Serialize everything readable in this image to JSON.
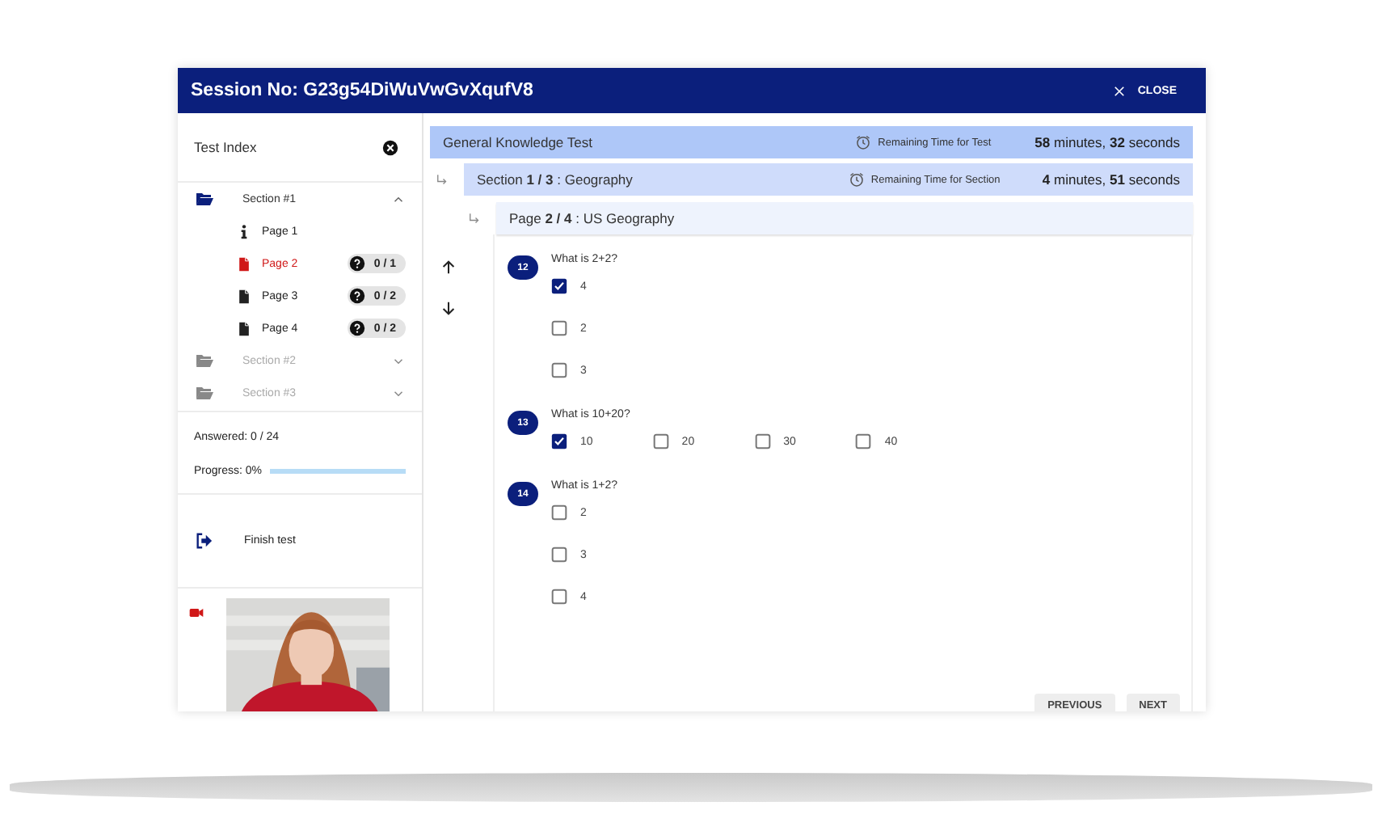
{
  "window": {
    "title": "Session No: G23g54DiWuVwGvXqufV8",
    "close_label": "CLOSE"
  },
  "sidebar": {
    "title": "Test Index",
    "sections": [
      {
        "label": "Section #1",
        "expanded": true,
        "disabled": false,
        "pages": [
          {
            "label": "Page 1",
            "kind": "info",
            "selected": false
          },
          {
            "label": "Page 2",
            "kind": "page",
            "selected": true,
            "badge": "0 / 1"
          },
          {
            "label": "Page 3",
            "kind": "page",
            "selected": false,
            "badge": "0 / 2"
          },
          {
            "label": "Page 4",
            "kind": "page",
            "selected": false,
            "badge": "0 / 2"
          }
        ]
      },
      {
        "label": "Section #2",
        "expanded": false,
        "disabled": true
      },
      {
        "label": "Section #3",
        "expanded": false,
        "disabled": true
      }
    ],
    "answered": "Answered: 0 / 24",
    "progress_label": "Progress: 0%",
    "progress": {
      "level": 0
    },
    "finish_label": "Finish test",
    "camera": {
      "on": true
    }
  },
  "test": {
    "title": "General Knowledge Test",
    "timer_label": "Remaining Time for Test",
    "time": "**58** minutes, **32** seconds"
  },
  "section": {
    "title": "Section  **1 / 3** : Geography",
    "timer_label": "Remaining Time for Section",
    "time": "**4** minutes, **51** seconds"
  },
  "page": {
    "title": "Page  **2 / 4** : US Geography"
  },
  "questions": [
    {
      "number": "12",
      "text": "What is 2+2?",
      "kind": "column",
      "options": [
        {
          "label": "4",
          "checked": true
        },
        {
          "label": "2",
          "checked": false
        },
        {
          "label": "3",
          "checked": false
        }
      ]
    },
    {
      "number": "13",
      "text": "What is 10+20?",
      "kind": "row",
      "options": [
        {
          "label": "10",
          "checked": true
        },
        {
          "label": "20",
          "checked": false
        },
        {
          "label": "30",
          "checked": false
        },
        {
          "label": "40",
          "checked": false
        }
      ]
    },
    {
      "number": "14",
      "text": "What is 1+2?",
      "kind": "column",
      "options": [
        {
          "label": "2",
          "checked": false
        },
        {
          "label": "3",
          "checked": false
        },
        {
          "label": "4",
          "checked": false
        }
      ]
    }
  ],
  "buttons": [
    "PREVIOUS",
    "NEXT"
  ]
}
